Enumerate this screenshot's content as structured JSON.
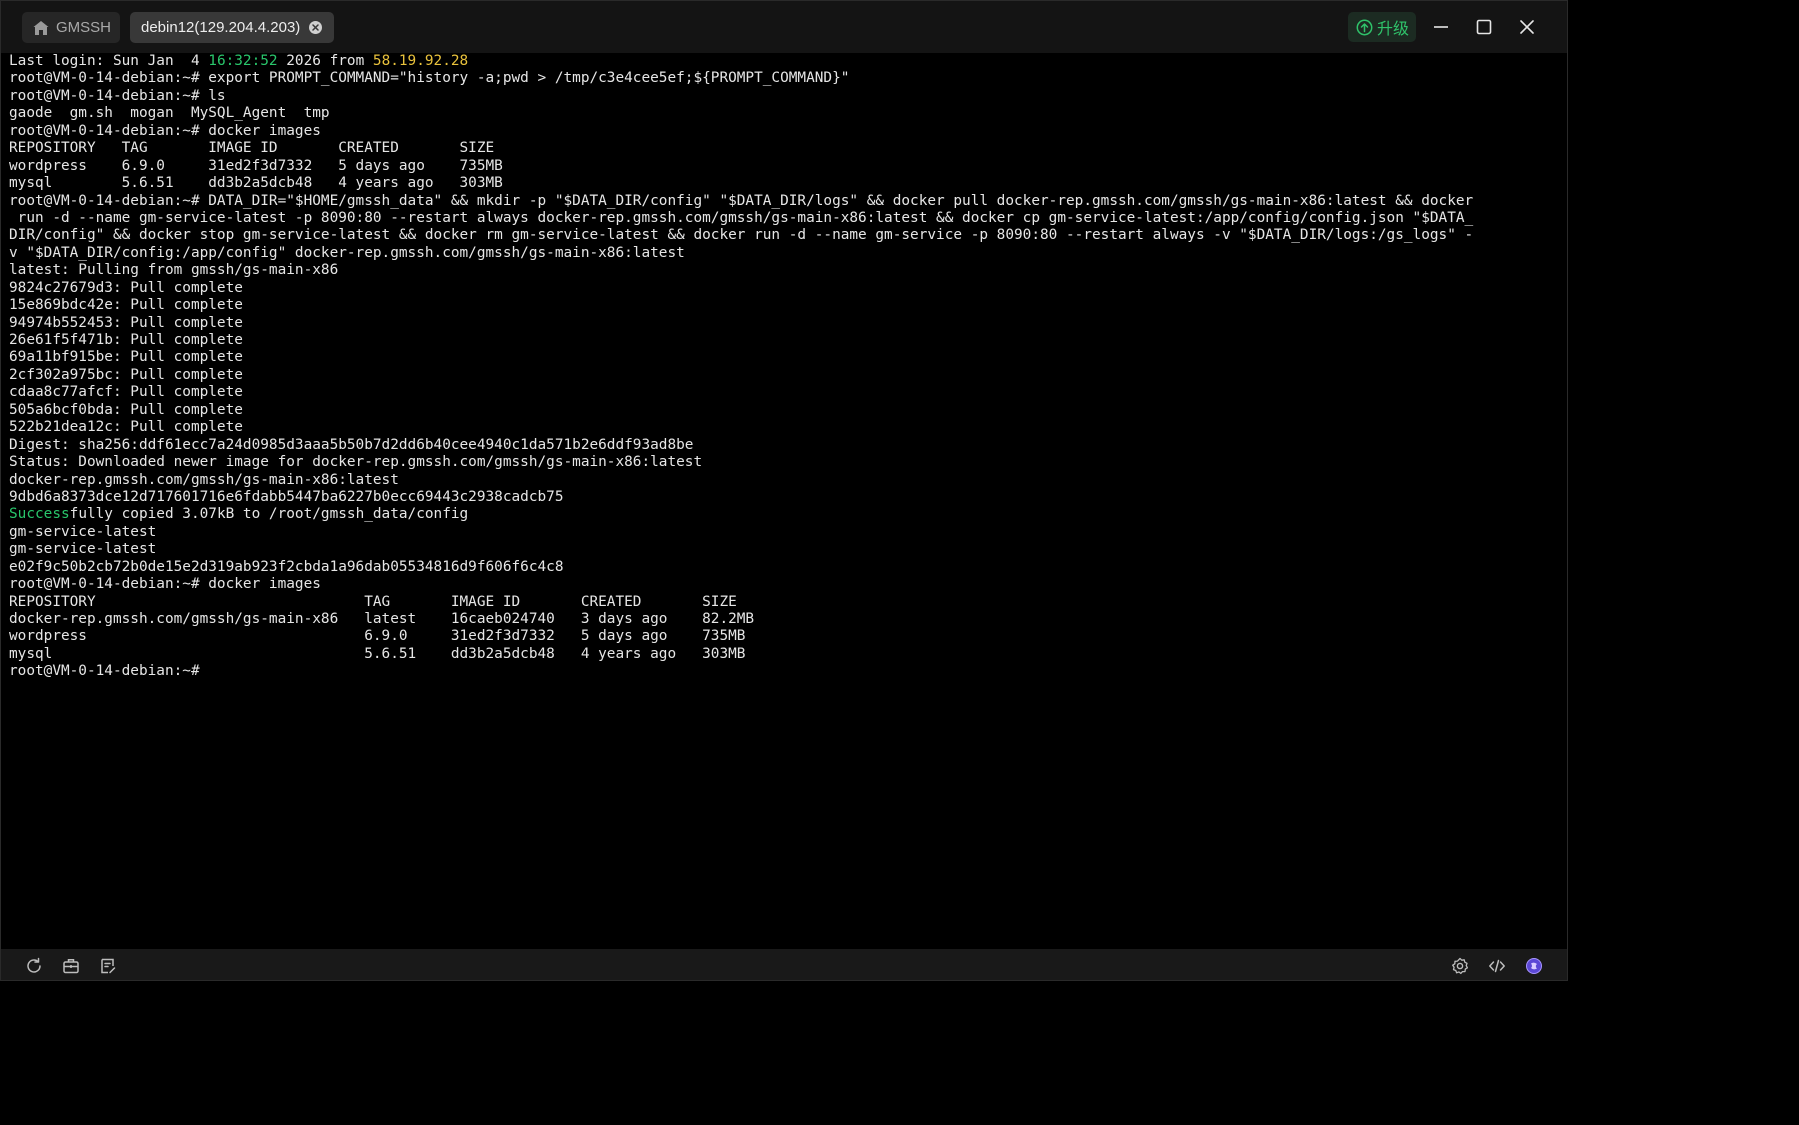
{
  "tabs": {
    "home_label": "GMSSH",
    "active_label": "debin12(129.204.4.203)"
  },
  "window": {
    "upgrade_label": "升级"
  },
  "colors": {
    "background": "#000000",
    "text": "#e6e6e6",
    "green": "#29c66b",
    "yellow": "#e9c23c",
    "titlebar": "#141414",
    "statusbar": "#191919"
  },
  "icons": {
    "home": "home-icon",
    "tab_close": "close-circle-icon",
    "upgrade": "arrow-up-circle-icon",
    "minimize": "minimize-icon",
    "maximize": "maximize-icon",
    "close": "close-icon",
    "reload": "reload-icon",
    "briefcase": "briefcase-icon",
    "notes": "notes-icon",
    "settings": "gear-icon",
    "code": "code-icon",
    "assistant": "ai-assistant-icon"
  },
  "terminal": {
    "lines": [
      [
        {
          "t": "Last login: Sun Jan  4 "
        },
        {
          "t": "16:32:52",
          "c": "green"
        },
        {
          "t": " 2026 from "
        },
        {
          "t": "58.19.92.28",
          "c": "yellow"
        }
      ],
      [
        {
          "t": "root@VM-0-14-debian:~# export PROMPT_COMMAND=\"history -a;pwd > /tmp/c3e4cee5ef;${PROMPT_COMMAND}\""
        }
      ],
      [
        {
          "t": "root@VM-0-14-debian:~# ls"
        }
      ],
      [
        {
          "t": "gaode  gm.sh  mogan  MySQL_Agent  tmp"
        }
      ],
      [
        {
          "t": "root@VM-0-14-debian:~# docker images"
        }
      ],
      [
        {
          "t": "REPOSITORY   TAG       IMAGE ID       CREATED       SIZE"
        }
      ],
      [
        {
          "t": "wordpress    6.9.0     31ed2f3d7332   5 days ago    735MB"
        }
      ],
      [
        {
          "t": "mysql        5.6.51    dd3b2a5dcb48   4 years ago   303MB"
        }
      ],
      [
        {
          "t": "root@VM-0-14-debian:~# DATA_DIR=\"$HOME/gmssh_data\" && mkdir -p \"$DATA_DIR/config\" \"$DATA_DIR/logs\" && docker pull docker-rep.gmssh.com/gmssh/gs-main-x86:latest && docker"
        }
      ],
      [
        {
          "t": " run -d --name gm-service-latest -p 8090:80 --restart always docker-rep.gmssh.com/gmssh/gs-main-x86:latest && docker cp gm-service-latest:/app/config/config.json \"$DATA_"
        }
      ],
      [
        {
          "t": "DIR/config\" && docker stop gm-service-latest && docker rm gm-service-latest && docker run -d --name gm-service -p 8090:80 --restart always -v \"$DATA_DIR/logs:/gs_logs\" -"
        }
      ],
      [
        {
          "t": "v \"$DATA_DIR/config:/app/config\" docker-rep.gmssh.com/gmssh/gs-main-x86:latest"
        }
      ],
      [
        {
          "t": "latest: Pulling from gmssh/gs-main-x86"
        }
      ],
      [
        {
          "t": "9824c27679d3: Pull complete"
        }
      ],
      [
        {
          "t": "15e869bdc42e: Pull complete"
        }
      ],
      [
        {
          "t": "94974b552453: Pull complete"
        }
      ],
      [
        {
          "t": "26e61f5f471b: Pull complete"
        }
      ],
      [
        {
          "t": "69a11bf915be: Pull complete"
        }
      ],
      [
        {
          "t": "2cf302a975bc: Pull complete"
        }
      ],
      [
        {
          "t": "cdaa8c77afcf: Pull complete"
        }
      ],
      [
        {
          "t": "505a6bcf0bda: Pull complete"
        }
      ],
      [
        {
          "t": "522b21dea12c: Pull complete"
        }
      ],
      [
        {
          "t": "Digest: sha256:ddf61ecc7a24d0985d3aaa5b50b7d2dd6b40cee4940c1da571b2e6ddf93ad8be"
        }
      ],
      [
        {
          "t": "Status: Downloaded newer image for docker-rep.gmssh.com/gmssh/gs-main-x86:latest"
        }
      ],
      [
        {
          "t": "docker-rep.gmssh.com/gmssh/gs-main-x86:latest"
        }
      ],
      [
        {
          "t": "9dbd6a8373dce12d717601716e6fdabb5447ba6227b0ecc69443c2938cadcb75"
        }
      ],
      [
        {
          "t": "Success",
          "c": "green"
        },
        {
          "t": "fully copied 3.07kB to /root/gmssh_data/config"
        }
      ],
      [
        {
          "t": "gm-service-latest"
        }
      ],
      [
        {
          "t": "gm-service-latest"
        }
      ],
      [
        {
          "t": "e02f9c50b2cb72b0de15e2d319ab923f2cbda1a96dab05534816d9f606f6c4c8"
        }
      ],
      [
        {
          "t": "root@VM-0-14-debian:~# docker images"
        }
      ],
      [
        {
          "t": "REPOSITORY                               TAG       IMAGE ID       CREATED       SIZE"
        }
      ],
      [
        {
          "t": "docker-rep.gmssh.com/gmssh/gs-main-x86   latest    16caeb024740   3 days ago    82.2MB"
        }
      ],
      [
        {
          "t": "wordpress                                6.9.0     31ed2f3d7332   5 days ago    735MB"
        }
      ],
      [
        {
          "t": "mysql                                    5.6.51    dd3b2a5dcb48   4 years ago   303MB"
        }
      ],
      [
        {
          "t": "root@VM-0-14-debian:~#"
        }
      ]
    ]
  }
}
